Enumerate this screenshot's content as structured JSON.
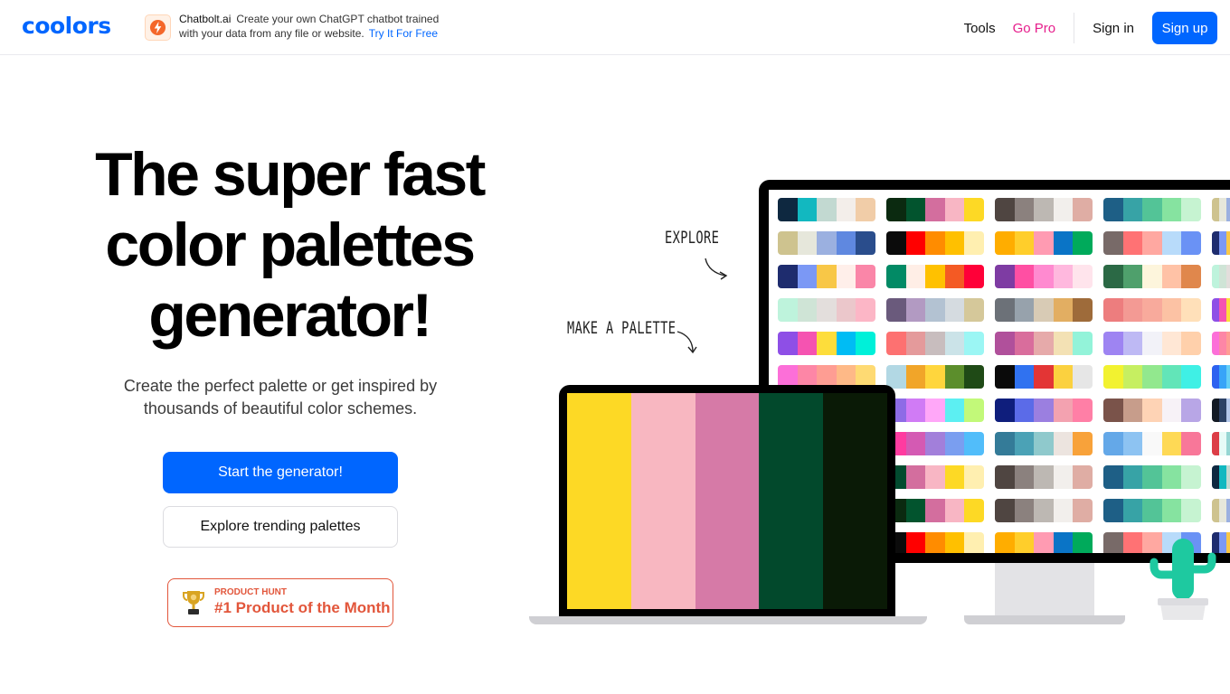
{
  "header": {
    "logo": "coolors",
    "ad": {
      "brand": "Chatbolt.ai",
      "line1": "Create your own ChatGPT chatbot trained",
      "line2": "with your data from any file or website.",
      "cta": "Try It For Free"
    },
    "nav": {
      "tools": "Tools",
      "go_pro": "Go Pro",
      "sign_in": "Sign in",
      "sign_up": "Sign up"
    }
  },
  "hero": {
    "title_line1": "The super fast",
    "title_line2": "color palettes",
    "title_line3": "generator!",
    "subtitle_line1": "Create the perfect palette or get inspired by",
    "subtitle_line2": "thousands of beautiful color schemes.",
    "primary_button": "Start the generator!",
    "secondary_button": "Explore trending palettes",
    "badge": {
      "kicker": "PRODUCT HUNT",
      "title": "#1 Product of the Month"
    }
  },
  "illustration": {
    "explore_label": "EXPLORE",
    "make_label": "MAKE A PALETTE",
    "laptop_palette": [
      "#FDD925",
      "#F8B7C1",
      "#D67AA7",
      "#02492C",
      "#0A1A06"
    ],
    "monitor_palettes": [
      [
        "#0E2840",
        "#12B8C0",
        "#C2D9D1",
        "#F3EEEA",
        "#F1CDA8"
      ],
      [
        "#0B2A10",
        "#02542E",
        "#D36E9E",
        "#F8B6C4",
        "#FDD925"
      ],
      [
        "#4F4541",
        "#8B817E",
        "#BDB8B3",
        "#F2EFEC",
        "#DFADA4"
      ],
      [
        "#1E5F86",
        "#37A3A6",
        "#53C497",
        "#86E3A0",
        "#C6F3D1"
      ],
      [
        "#CEC38F",
        "#E6E7DB",
        "#9BB0E0",
        "#5F88E0",
        "#2A4D8C"
      ],
      [
        "#0B0B0B",
        "#FF0000",
        "#FF8C00",
        "#FFC000",
        "#FFEFB0"
      ],
      [
        "#FFAD00",
        "#FFCE2B",
        "#FF9BB2",
        "#0A74C6",
        "#00AA5B"
      ],
      [
        "#786A68",
        "#FF7274",
        "#FFA8A1",
        "#B8DBFA",
        "#6A92F5"
      ],
      [
        "#1E2C6E",
        "#7B98F5",
        "#F8C747",
        "#FFEFEA",
        "#FA86A8"
      ],
      [
        "#028A65",
        "#FFEEE6",
        "#FFC100",
        "#F45A24",
        "#FF0038"
      ],
      [
        "#7E3CA3",
        "#FF4FA3",
        "#FF8AD0",
        "#FFB8DE",
        "#FFE4EC"
      ],
      [
        "#2B6945",
        "#4FA06C",
        "#FDF5DC",
        "#FFC2A6",
        "#E0874C"
      ],
      [
        "#BEF3DC",
        "#CFE4D6",
        "#E3DEDC",
        "#EBC7CB",
        "#FCB6C6"
      ],
      [
        "#6A5A7C",
        "#B29AC2",
        "#B3C2D2",
        "#D5DBE0",
        "#D5C89A"
      ],
      [
        "#6C7178",
        "#97A2AC",
        "#D8CBB5",
        "#E2AE62",
        "#9E6B3A"
      ],
      [
        "#ED7D7E",
        "#F39A94",
        "#F8AA9C",
        "#FCC2A4",
        "#FFE0B9"
      ],
      [
        "#8E4FE6",
        "#F553B1",
        "#FDDD3B",
        "#00BCF4",
        "#00F0D9"
      ],
      [
        "#FD7171",
        "#E49A9B",
        "#C8BDBE",
        "#CBE3E8",
        "#9BF6F4"
      ],
      [
        "#B0509B",
        "#D96D9C",
        "#E6AAAA",
        "#F3E1B4",
        "#93F3D9"
      ],
      [
        "#9E84F2",
        "#BEB9F4",
        "#F2F2F8",
        "#FFE7D5",
        "#FFD0AB"
      ],
      [
        "#FC6FD8",
        "#FD86A6",
        "#FE9D93",
        "#FEB987",
        "#FEDA73"
      ],
      [
        "#B2D8E4",
        "#F1A529",
        "#FFD63D",
        "#5C8E2C",
        "#1F4A16"
      ],
      [
        "#0A0A0A",
        "#3072F0",
        "#E33535",
        "#FBD13F",
        "#E6E6E6"
      ],
      [
        "#F2F230",
        "#C6EF61",
        "#92E88E",
        "#62E5B8",
        "#3FF0E5"
      ],
      [
        "#2D62F0",
        "#38A4F8",
        "#64CFF6",
        "#FFF322",
        "#FFBF1D"
      ],
      [
        "#8E6BE6",
        "#D07BF5",
        "#FFA7F8",
        "#5CEFF2",
        "#C2F979"
      ],
      [
        "#0F1E7C",
        "#5B6BE8",
        "#9B7FE0",
        "#F3A2B0",
        "#FF7FA6"
      ],
      [
        "#7A534A",
        "#C79D8B",
        "#FED3B5",
        "#F7F2F7",
        "#B8A6E6"
      ],
      [
        "#131A24",
        "#2D4266",
        "#B3C7EA",
        "#E4E9EE",
        "#BDC997"
      ],
      [
        "#FF3BA0",
        "#D45AB3",
        "#A27FDA",
        "#7A9EF0",
        "#51BDFA"
      ],
      [
        "#347B98",
        "#4BA2B6",
        "#8FC9CC",
        "#ECE4DF",
        "#F8A23A"
      ],
      [
        "#64A8E8",
        "#8DC3F2",
        "#F9F9F9",
        "#FED955",
        "#F87799"
      ],
      [
        "#DC3E47",
        "#E6FBF7",
        "#96D6D3",
        "#4B7B9E",
        "#213659"
      ],
      [
        "#024B2F",
        "#D36E9E",
        "#F8B6C4",
        "#FDD925",
        "#FFEFB0"
      ],
      [
        "#4F4541",
        "#8B817E",
        "#BDB8B3",
        "#F2EFEC",
        "#DFADA4"
      ],
      [
        "#1E5F86",
        "#37A3A6",
        "#53C497",
        "#86E3A0",
        "#C6F3D1"
      ]
    ]
  }
}
